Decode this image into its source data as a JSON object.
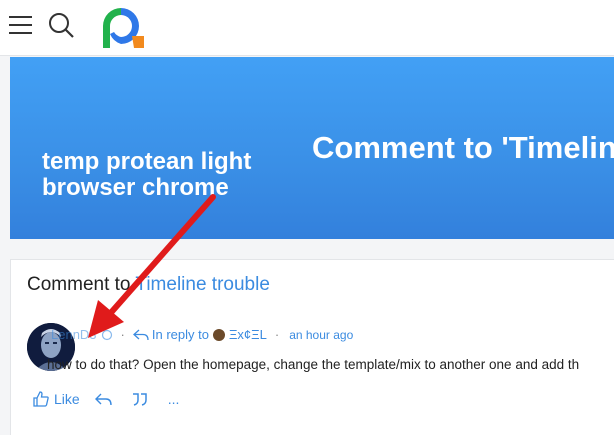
{
  "banner": {
    "left_text": "temp protean light browser chrome",
    "right_text": "Comment to 'Timeline"
  },
  "comment": {
    "title_prefix": "Comment to ",
    "title_link": "Timeline trouble",
    "username": "LennD3",
    "reply_label": "In reply to",
    "reply_target": "Ξx¢ΞL",
    "time": "an hour ago",
    "body": "how to do that? Open the homepage, change the template/mix to another one and add th",
    "like_label": "Like",
    "more_label": "..."
  },
  "colors": {
    "accent": "#3b8be0",
    "banner": "#3a8fe6",
    "arrow": "#e01b1b"
  }
}
